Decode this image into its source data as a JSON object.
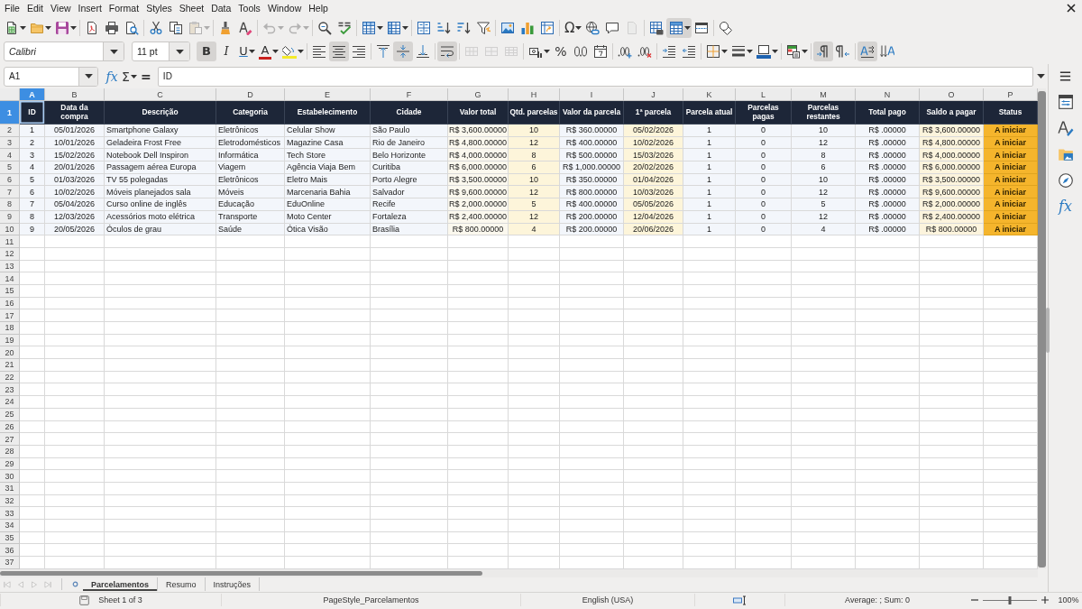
{
  "menu_bar": {
    "items": [
      "File",
      "Edit",
      "View",
      "Insert",
      "Format",
      "Styles",
      "Sheet",
      "Data",
      "Tools",
      "Window",
      "Help"
    ]
  },
  "standard_toolbar": [
    [
      {
        "kind": "new",
        "dropdown": true,
        "disabled": false,
        "pressed": false
      },
      {
        "kind": "open",
        "dropdown": true,
        "disabled": false,
        "pressed": false
      },
      {
        "kind": "save",
        "dropdown": true,
        "disabled": false,
        "pressed": false
      }
    ],
    [
      {
        "kind": "pdf",
        "dropdown": false,
        "disabled": false,
        "pressed": false
      },
      {
        "kind": "print",
        "dropdown": false,
        "disabled": false,
        "pressed": false
      },
      {
        "kind": "preview",
        "dropdown": false,
        "disabled": false,
        "pressed": false
      }
    ],
    [
      {
        "kind": "cut",
        "dropdown": false,
        "disabled": false,
        "pressed": false
      },
      {
        "kind": "copy",
        "dropdown": false,
        "disabled": false,
        "pressed": false
      },
      {
        "kind": "paste",
        "dropdown": true,
        "disabled": true,
        "pressed": false
      }
    ],
    [
      {
        "kind": "clone",
        "dropdown": false,
        "disabled": false,
        "pressed": false
      },
      {
        "kind": "clear",
        "dropdown": false,
        "disabled": false,
        "pressed": false
      }
    ],
    [
      {
        "kind": "undo",
        "dropdown": true,
        "disabled": true,
        "pressed": false
      },
      {
        "kind": "redo",
        "dropdown": true,
        "disabled": true,
        "pressed": false
      }
    ],
    [
      {
        "kind": "find",
        "dropdown": false,
        "disabled": false,
        "pressed": false
      },
      {
        "kind": "spelling",
        "dropdown": false,
        "disabled": false,
        "pressed": false
      }
    ],
    [
      {
        "kind": "rows",
        "dropdown": true,
        "disabled": false,
        "pressed": false
      },
      {
        "kind": "columns",
        "dropdown": true,
        "disabled": false,
        "pressed": false
      }
    ],
    [
      {
        "kind": "sort",
        "dropdown": false,
        "disabled": false,
        "pressed": false
      },
      {
        "kind": "ascending",
        "dropdown": false,
        "disabled": false,
        "pressed": false
      },
      {
        "kind": "descending",
        "dropdown": false,
        "disabled": false,
        "pressed": false
      },
      {
        "kind": "filter",
        "dropdown": false,
        "disabled": false,
        "pressed": false
      }
    ],
    [
      {
        "kind": "image",
        "dropdown": false,
        "disabled": false,
        "pressed": false
      },
      {
        "kind": "chart",
        "dropdown": false,
        "disabled": false,
        "pressed": false
      },
      {
        "kind": "pivot",
        "dropdown": false,
        "disabled": false,
        "pressed": false
      }
    ],
    [
      {
        "kind": "symbol",
        "label": "Ω",
        "dropdown": true,
        "disabled": false,
        "pressed": false
      },
      {
        "kind": "hyperlink",
        "dropdown": false,
        "disabled": false,
        "pressed": false
      },
      {
        "kind": "comment",
        "dropdown": false,
        "disabled": false,
        "pressed": false
      },
      {
        "kind": "headers",
        "dropdown": false,
        "disabled": true,
        "pressed": false
      }
    ],
    [
      {
        "kind": "printarea",
        "dropdown": false,
        "disabled": false,
        "pressed": false
      },
      {
        "kind": "freeze",
        "dropdown": true,
        "disabled": false,
        "pressed": true
      },
      {
        "kind": "split",
        "dropdown": false,
        "disabled": false,
        "pressed": false
      }
    ],
    [
      {
        "kind": "shapes",
        "dropdown": false,
        "disabled": false,
        "pressed": false
      }
    ]
  ],
  "formatting_toolbar": {
    "font_name": "Calibri",
    "font_size": "11 pt",
    "groups": [
      [
        {
          "kind": "bold",
          "label": "B",
          "dropdown": false,
          "disabled": false,
          "pressed": true
        },
        {
          "kind": "italic",
          "label": "I",
          "dropdown": false,
          "disabled": false,
          "pressed": false
        },
        {
          "kind": "underline",
          "label": "U",
          "dropdown": true,
          "disabled": false,
          "pressed": false
        },
        {
          "kind": "fontcolor",
          "label": "A",
          "dropdown": true,
          "disabled": false,
          "pressed": false
        },
        {
          "kind": "highlight",
          "dropdown": true,
          "disabled": false,
          "pressed": false
        }
      ],
      [
        {
          "kind": "left",
          "dropdown": false,
          "disabled": false,
          "pressed": false
        },
        {
          "kind": "center",
          "dropdown": false,
          "disabled": false,
          "pressed": true
        },
        {
          "kind": "right",
          "dropdown": false,
          "disabled": false,
          "pressed": false
        }
      ],
      [
        {
          "kind": "top",
          "dropdown": false,
          "disabled": false,
          "pressed": false
        },
        {
          "kind": "middle",
          "dropdown": false,
          "disabled": false,
          "pressed": true
        },
        {
          "kind": "bottom",
          "dropdown": false,
          "disabled": false,
          "pressed": false
        }
      ],
      [
        {
          "kind": "wrap",
          "dropdown": false,
          "disabled": false,
          "pressed": true
        }
      ],
      [
        {
          "kind": "mergecenter",
          "dropdown": false,
          "disabled": true,
          "pressed": false
        },
        {
          "kind": "merge",
          "dropdown": false,
          "disabled": true,
          "pressed": false
        },
        {
          "kind": "unmerge",
          "dropdown": false,
          "disabled": true,
          "pressed": false
        }
      ],
      [
        {
          "kind": "currency",
          "dropdown": true,
          "disabled": false,
          "pressed": false
        },
        {
          "kind": "percent",
          "label": "%",
          "dropdown": false,
          "disabled": false,
          "pressed": false
        },
        {
          "kind": "number",
          "dropdown": false,
          "disabled": false,
          "pressed": false
        },
        {
          "kind": "date",
          "dropdown": false,
          "disabled": false,
          "pressed": false
        }
      ],
      [
        {
          "kind": "adddecimal",
          "dropdown": false,
          "disabled": false,
          "pressed": false
        },
        {
          "kind": "deldecimal",
          "dropdown": false,
          "disabled": false,
          "pressed": false
        }
      ],
      [
        {
          "kind": "indent",
          "dropdown": false,
          "disabled": false,
          "pressed": false
        },
        {
          "kind": "outdent",
          "dropdown": false,
          "disabled": false,
          "pressed": false
        }
      ],
      [
        {
          "kind": "borders",
          "dropdown": true,
          "disabled": false,
          "pressed": false
        },
        {
          "kind": "borderstyle",
          "dropdown": true,
          "disabled": false,
          "pressed": false
        },
        {
          "kind": "bordercolor",
          "dropdown": true,
          "disabled": false,
          "pressed": false
        }
      ],
      [
        {
          "kind": "conditional",
          "dropdown": true,
          "disabled": false,
          "pressed": false
        }
      ],
      [
        {
          "kind": "ltr",
          "dropdown": false,
          "disabled": false,
          "pressed": true
        },
        {
          "kind": "rtl",
          "dropdown": false,
          "disabled": false,
          "pressed": false
        }
      ],
      [
        {
          "kind": "textflow",
          "dropdown": false,
          "disabled": false,
          "pressed": true
        },
        {
          "kind": "vertical",
          "dropdown": false,
          "disabled": false,
          "pressed": false
        }
      ]
    ]
  },
  "formula_bar": {
    "name_box": "A1",
    "tools": [
      {
        "kind": "function",
        "label": "fx",
        "dropdown": false
      },
      {
        "kind": "sum",
        "label": "Σ",
        "dropdown": true
      },
      {
        "kind": "formula",
        "label": "=",
        "dropdown": false
      }
    ],
    "formula": "ID"
  },
  "sheet": {
    "columns": [
      {
        "label": "A",
        "selected": true
      },
      {
        "label": "B",
        "selected": false
      },
      {
        "label": "C",
        "selected": false
      },
      {
        "label": "D",
        "selected": false
      },
      {
        "label": "E",
        "selected": false
      },
      {
        "label": "F",
        "selected": false
      },
      {
        "label": "G",
        "selected": false
      },
      {
        "label": "H",
        "selected": false
      },
      {
        "label": "I",
        "selected": false
      },
      {
        "label": "J",
        "selected": false
      },
      {
        "label": "K",
        "selected": false
      },
      {
        "label": "L",
        "selected": false
      },
      {
        "label": "M",
        "selected": false
      },
      {
        "label": "N",
        "selected": false
      },
      {
        "label": "O",
        "selected": false
      },
      {
        "label": "P",
        "selected": false
      }
    ],
    "rows": [
      {
        "label": "1",
        "selected": true,
        "kind": "heading",
        "cells": [
          "ID",
          "Data da compra",
          "Descrição",
          "Categoria",
          "Estabelecimento",
          "Cidade",
          "Valor total",
          "Qtd. parcelas",
          "Valor da parcela",
          "1ª parcela",
          "Parcela atual",
          "Parcelas pagas",
          "Parcelas restantes",
          "Total pago",
          "Saldo a pagar",
          "Status"
        ]
      },
      {
        "label": "2",
        "selected": false,
        "kind": "data",
        "cells": [
          "1",
          "05/01/2026",
          "Smartphone Galaxy",
          "Eletrônicos",
          "Celular Show",
          "São Paulo",
          "R$ 3,600.00000",
          "10",
          "R$ 360.00000",
          "05/02/2026",
          "1",
          "0",
          "10",
          "R$ .00000",
          "R$ 3,600.00000",
          "A iniciar"
        ]
      },
      {
        "label": "3",
        "selected": false,
        "kind": "data",
        "cells": [
          "2",
          "10/01/2026",
          "Geladeira Frost Free",
          "Eletrodomésticos",
          "Magazine Casa",
          "Rio de Janeiro",
          "R$ 4,800.00000",
          "12",
          "R$ 400.00000",
          "10/02/2026",
          "1",
          "0",
          "12",
          "R$ .00000",
          "R$ 4,800.00000",
          "A iniciar"
        ]
      },
      {
        "label": "4",
        "selected": false,
        "kind": "data",
        "cells": [
          "3",
          "15/02/2026",
          "Notebook Dell Inspiron",
          "Informática",
          "Tech Store",
          "Belo Horizonte",
          "R$ 4,000.00000",
          "8",
          "R$ 500.00000",
          "15/03/2026",
          "1",
          "0",
          "8",
          "R$ .00000",
          "R$ 4,000.00000",
          "A iniciar"
        ]
      },
      {
        "label": "5",
        "selected": false,
        "kind": "data",
        "cells": [
          "4",
          "20/01/2026",
          "Passagem aérea Europa",
          "Viagem",
          "Agência Viaja Bem",
          "Curitiba",
          "R$ 6,000.00000",
          "6",
          "R$ 1,000.00000",
          "20/02/2026",
          "1",
          "0",
          "6",
          "R$ .00000",
          "R$ 6,000.00000",
          "A iniciar"
        ]
      },
      {
        "label": "6",
        "selected": false,
        "kind": "data",
        "cells": [
          "5",
          "01/03/2026",
          "TV 55 polegadas",
          "Eletrônicos",
          "Eletro Mais",
          "Porto Alegre",
          "R$ 3,500.00000",
          "10",
          "R$ 350.00000",
          "01/04/2026",
          "1",
          "0",
          "10",
          "R$ .00000",
          "R$ 3,500.00000",
          "A iniciar"
        ]
      },
      {
        "label": "7",
        "selected": false,
        "kind": "data",
        "cells": [
          "6",
          "10/02/2026",
          "Móveis planejados sala",
          "Móveis",
          "Marcenaria Bahia",
          "Salvador",
          "R$ 9,600.00000",
          "12",
          "R$ 800.00000",
          "10/03/2026",
          "1",
          "0",
          "12",
          "R$ .00000",
          "R$ 9,600.00000",
          "A iniciar"
        ]
      },
      {
        "label": "8",
        "selected": false,
        "kind": "data",
        "cells": [
          "7",
          "05/04/2026",
          "Curso online de inglês",
          "Educação",
          "EduOnline",
          "Recife",
          "R$ 2,000.00000",
          "5",
          "R$ 400.00000",
          "05/05/2026",
          "1",
          "0",
          "5",
          "R$ .00000",
          "R$ 2,000.00000",
          "A iniciar"
        ]
      },
      {
        "label": "9",
        "selected": false,
        "kind": "data",
        "cells": [
          "8",
          "12/03/2026",
          "Acessórios moto elétrica",
          "Transporte",
          "Moto Center",
          "Fortaleza",
          "R$ 2,400.00000",
          "12",
          "R$ 200.00000",
          "12/04/2026",
          "1",
          "0",
          "12",
          "R$ .00000",
          "R$ 2,400.00000",
          "A iniciar"
        ]
      },
      {
        "label": "10",
        "selected": false,
        "kind": "data",
        "cells": [
          "9",
          "20/05/2026",
          "Óculos de grau",
          "Saúde",
          "Ótica Visão",
          "Brasília",
          "R$ 800.00000",
          "4",
          "R$ 200.00000",
          "20/06/2026",
          "1",
          "0",
          "4",
          "R$ .00000",
          "R$ 800.00000",
          "A iniciar"
        ]
      },
      {
        "label": "11",
        "selected": false,
        "kind": "empty"
      },
      {
        "label": "12",
        "selected": false,
        "kind": "empty"
      },
      {
        "label": "13",
        "selected": false,
        "kind": "empty"
      },
      {
        "label": "14",
        "selected": false,
        "kind": "empty"
      },
      {
        "label": "15",
        "selected": false,
        "kind": "empty"
      },
      {
        "label": "16",
        "selected": false,
        "kind": "empty"
      },
      {
        "label": "17",
        "selected": false,
        "kind": "empty"
      },
      {
        "label": "18",
        "selected": false,
        "kind": "empty"
      },
      {
        "label": "19",
        "selected": false,
        "kind": "empty"
      },
      {
        "label": "20",
        "selected": false,
        "kind": "empty"
      },
      {
        "label": "21",
        "selected": false,
        "kind": "empty"
      },
      {
        "label": "22",
        "selected": false,
        "kind": "empty"
      },
      {
        "label": "23",
        "selected": false,
        "kind": "empty"
      },
      {
        "label": "24",
        "selected": false,
        "kind": "empty"
      },
      {
        "label": "25",
        "selected": false,
        "kind": "empty"
      },
      {
        "label": "26",
        "selected": false,
        "kind": "empty"
      },
      {
        "label": "27",
        "selected": false,
        "kind": "empty"
      },
      {
        "label": "28",
        "selected": false,
        "kind": "empty"
      },
      {
        "label": "29",
        "selected": false,
        "kind": "empty"
      },
      {
        "label": "30",
        "selected": false,
        "kind": "empty"
      },
      {
        "label": "31",
        "selected": false,
        "kind": "empty"
      },
      {
        "label": "32",
        "selected": false,
        "kind": "empty"
      },
      {
        "label": "33",
        "selected": false,
        "kind": "empty"
      },
      {
        "label": "34",
        "selected": false,
        "kind": "empty"
      },
      {
        "label": "35",
        "selected": false,
        "kind": "empty"
      },
      {
        "label": "36",
        "selected": false,
        "kind": "empty"
      },
      {
        "label": "37",
        "selected": false,
        "kind": "empty"
      }
    ]
  },
  "sheet_nav": [
    {
      "kind": "first",
      "disabled": true
    },
    {
      "kind": "previous",
      "disabled": true
    },
    {
      "kind": "next",
      "disabled": true
    },
    {
      "kind": "last",
      "disabled": true
    }
  ],
  "sheet_tabs": [
    {
      "label": "Parcelamentos",
      "selected": true
    },
    {
      "label": "Resumo",
      "selected": false
    },
    {
      "label": "Instruções",
      "selected": false
    }
  ],
  "sidebar": {
    "tabs": [
      {
        "kind": "properties",
        "selected": false
      },
      {
        "kind": "styles",
        "selected": false
      },
      {
        "kind": "gallery",
        "selected": false
      },
      {
        "kind": "navigator",
        "selected": false
      },
      {
        "kind": "functions",
        "label": "fx",
        "selected": false
      }
    ]
  },
  "status_bar": {
    "sheet": "Sheet 1 of 3",
    "page_style": "PageStyle_Parcelamentos",
    "language": "English (USA)",
    "summary": "Average: ; Sum: 0",
    "zoom": {
      "level": 0.5,
      "percent": "100%"
    }
  }
}
